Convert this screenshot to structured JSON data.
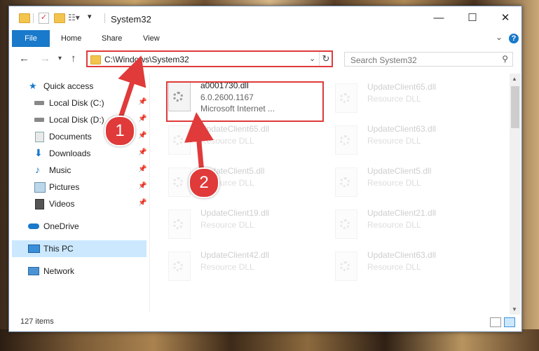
{
  "window": {
    "title": "System32"
  },
  "ribbon": {
    "tabs": [
      "File",
      "Home",
      "Share",
      "View"
    ]
  },
  "navbar": {
    "address": "C:\\Windows\\System32",
    "search_placeholder": "Search System32"
  },
  "sidebar": {
    "items": [
      {
        "label": "Quick access",
        "icon": "star-icon",
        "pinned": false
      },
      {
        "label": "Local Disk (C:)",
        "icon": "drive-icon",
        "pinned": true
      },
      {
        "label": "Local Disk (D:)",
        "icon": "drive-icon",
        "pinned": true
      },
      {
        "label": "Documents",
        "icon": "documents-icon",
        "pinned": true
      },
      {
        "label": "Downloads",
        "icon": "download-icon",
        "pinned": true
      },
      {
        "label": "Music",
        "icon": "music-icon",
        "pinned": true
      },
      {
        "label": "Pictures",
        "icon": "pictures-icon",
        "pinned": true
      },
      {
        "label": "Videos",
        "icon": "videos-icon",
        "pinned": true
      },
      {
        "label": "OneDrive",
        "icon": "cloud-icon",
        "pinned": false
      },
      {
        "label": "This PC",
        "icon": "computer-icon",
        "pinned": false,
        "selected": true
      },
      {
        "label": "Network",
        "icon": "network-icon",
        "pinned": false
      }
    ]
  },
  "files": {
    "highlighted": {
      "name": "a0001730.dll",
      "version": "6.0.2600.1167",
      "company": "Microsoft Internet ..."
    },
    "faded": [
      {
        "name": "UpdateClient65.dll",
        "type": "Resource DLL"
      },
      {
        "name": "UpdateClient65.dll",
        "type": "Resource DLL"
      },
      {
        "name": "UpdateClient63.dll",
        "type": "Resource DLL"
      },
      {
        "name": "UpdateClient5.dll",
        "type": "Resource DLL"
      },
      {
        "name": "UpdateClient5.dll",
        "type": "Resource DLL"
      },
      {
        "name": "UpdateClient19.dll",
        "type": "Resource DLL"
      },
      {
        "name": "UpdateClient21.dll",
        "type": "Resource DLL"
      },
      {
        "name": "UpdateClient42.dll",
        "type": "Resource DLL"
      },
      {
        "name": "UpdateClient63.dll",
        "type": "Resource DLL"
      }
    ]
  },
  "status": {
    "items_count": "127 items"
  },
  "annotations": {
    "step1": "1",
    "step2": "2"
  },
  "colors": {
    "accent": "#1979ca",
    "annotation": "#e03a3a",
    "selected": "#cce8ff"
  }
}
